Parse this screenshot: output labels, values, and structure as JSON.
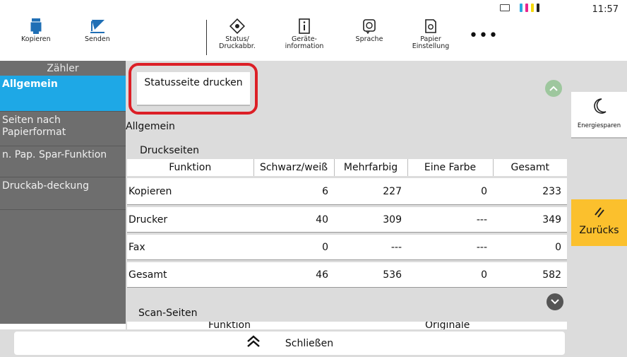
{
  "statusbar": {
    "time": "11:57",
    "ink_colors": [
      "#29a9e0",
      "#e8258e",
      "#f5d90a",
      "#222222"
    ]
  },
  "toolbar": {
    "copy_label": "Kopieren",
    "send_label": "Senden",
    "status_label": "Status/ Druckabbr.",
    "device_label": "Geräte- information",
    "language_label": "Sprache",
    "paper_label": "Papier Einstellung",
    "more_label": "•••"
  },
  "sidebar": {
    "header": "Zähler",
    "items": [
      {
        "label": "Allgemein",
        "active": true
      },
      {
        "label": "Seiten nach Papierformat",
        "active": false
      },
      {
        "label": "n. Pap. Spar-Funktion",
        "active": false
      },
      {
        "label": "Druckab-deckung",
        "active": false
      }
    ]
  },
  "main": {
    "status_button": "Statusseite drucken",
    "section": "Allgemein",
    "print_pages_label": "Druckseiten",
    "columns": [
      "Funktion",
      "Schwarz/weiß",
      "Mehrfarbig",
      "Eine Farbe",
      "Gesamt"
    ],
    "rows": [
      [
        "Kopieren",
        "6",
        "227",
        "0",
        "233"
      ],
      [
        "Drucker",
        "40",
        "309",
        "---",
        "349"
      ],
      [
        "Fax",
        "0",
        "---",
        "---",
        "0"
      ],
      [
        "Gesamt",
        "46",
        "536",
        "0",
        "582"
      ]
    ],
    "scan_label": "Scan-Seiten",
    "scan_columns": [
      "Funktion",
      "Originale"
    ]
  },
  "rightrail": {
    "energy_label": "Energiesparen",
    "back_label": "Zurücks"
  },
  "bottombar": {
    "close_label": "Schließen"
  },
  "colors": {
    "accent": "#1ea8e6",
    "highlight": "#dc1f26",
    "back_button": "#fbc02d"
  }
}
